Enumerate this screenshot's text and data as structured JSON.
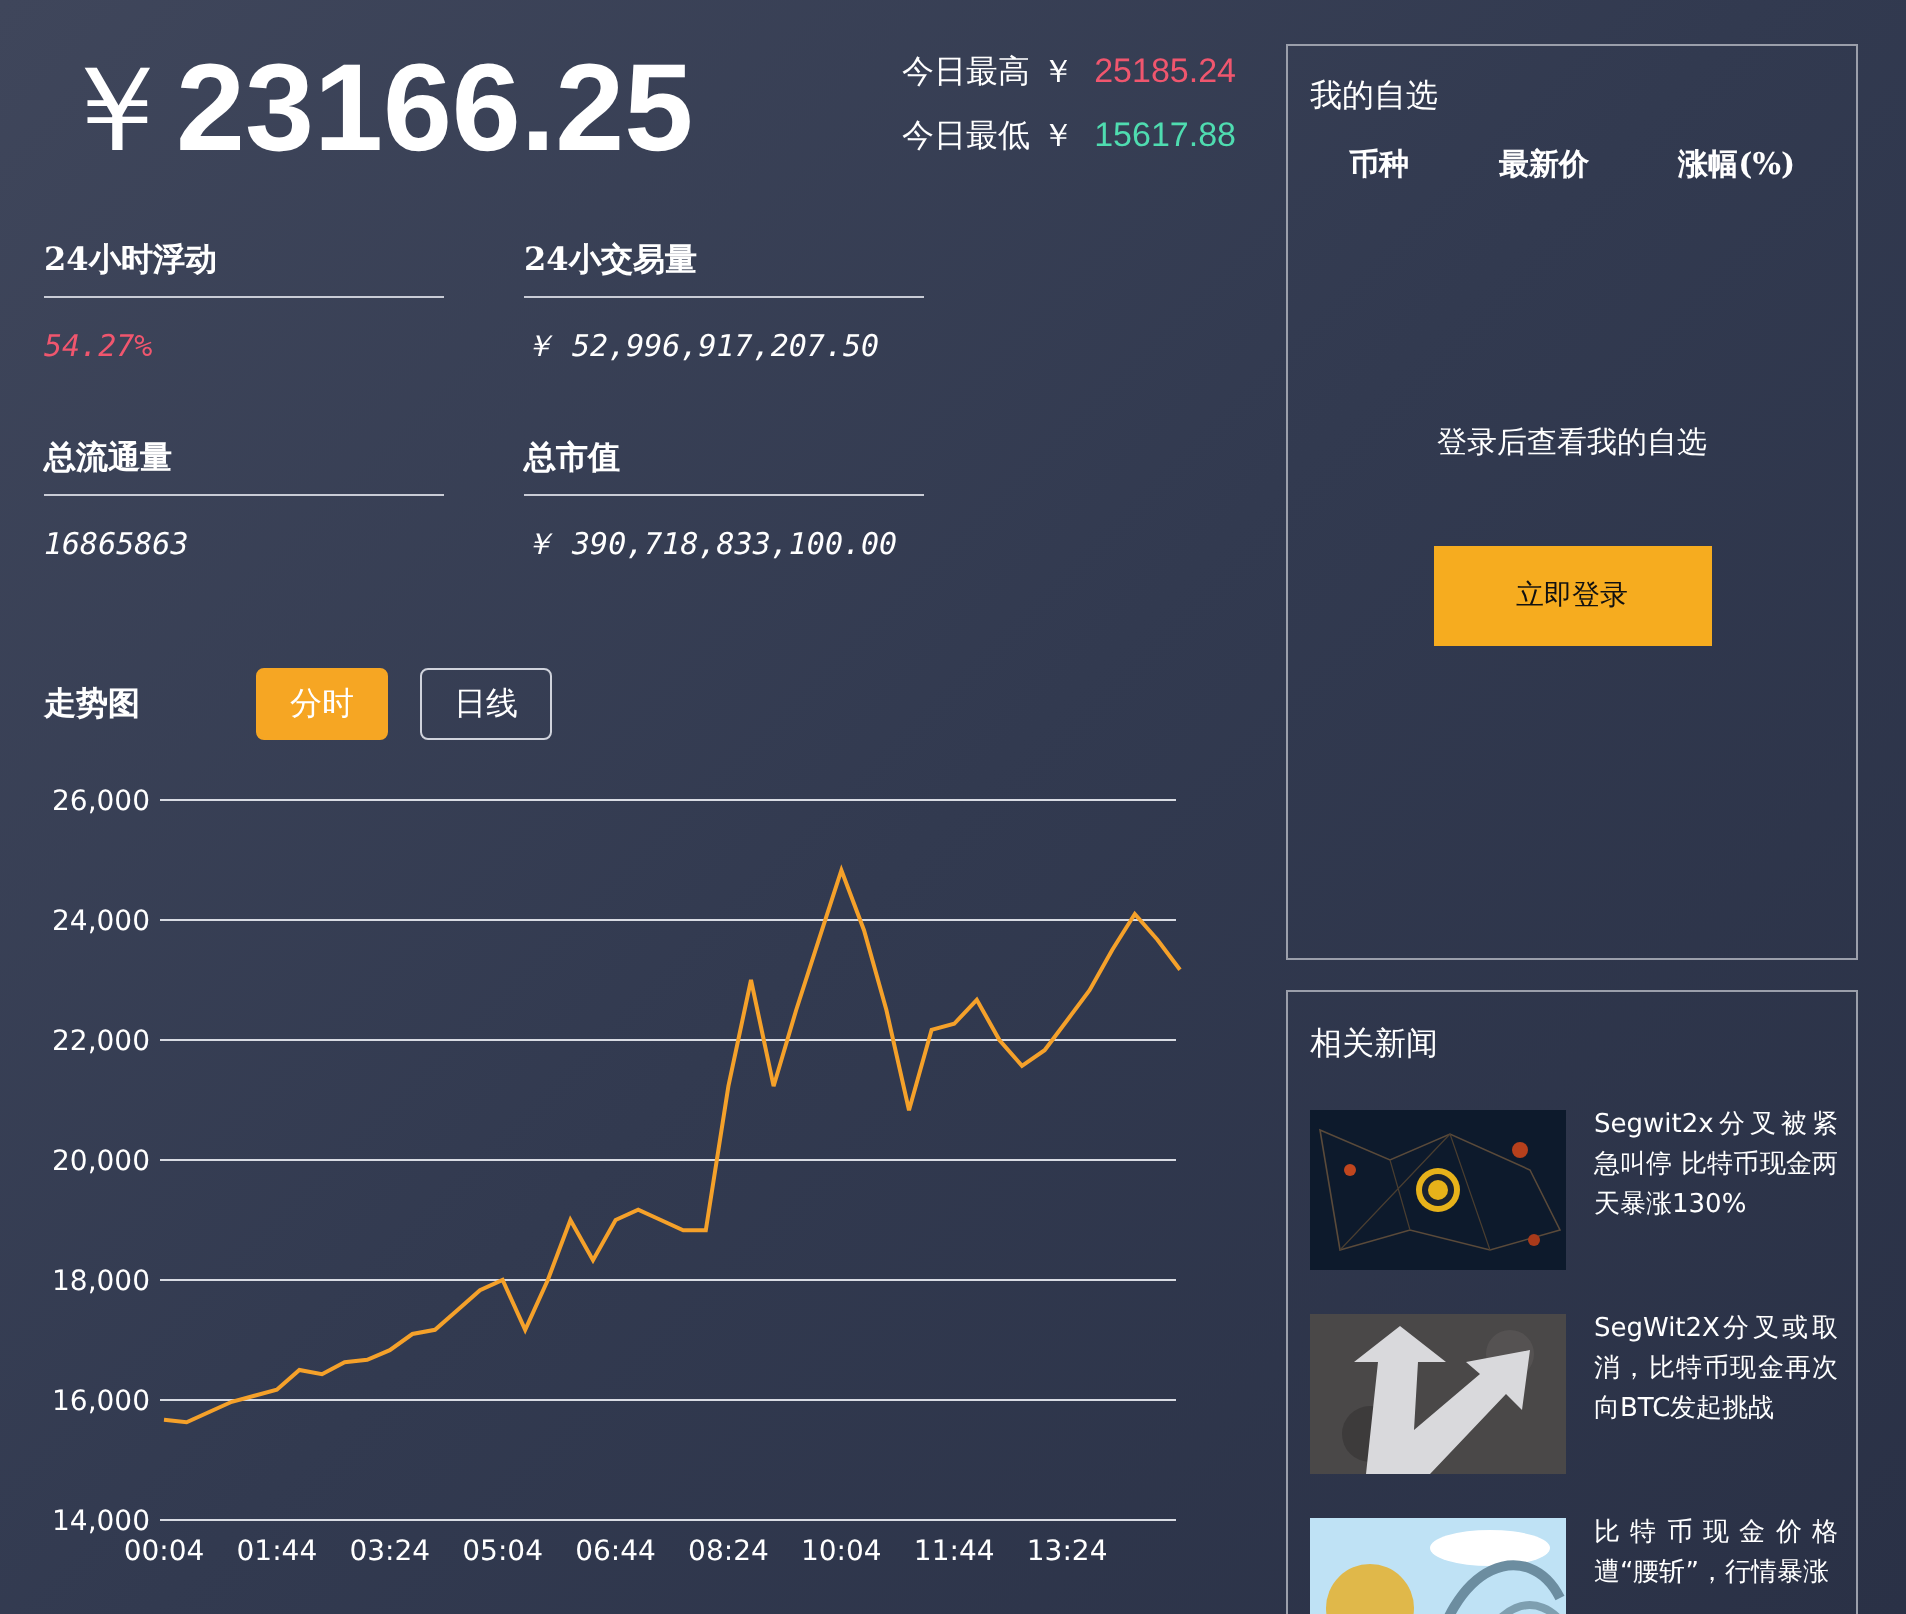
{
  "price": {
    "currency": "￥",
    "value": "23166.25"
  },
  "day_range": [
    {
      "label": "今日最高",
      "currency": "￥",
      "value": "25185.24",
      "color": "#f0566e"
    },
    {
      "label": "今日最低",
      "currency": "￥",
      "value": "15617.88",
      "color": "#4fdcb0"
    }
  ],
  "stats": [
    {
      "label": "24小时浮动",
      "value": "54.27%",
      "color": "#f0566e"
    },
    {
      "label": "24小交易量",
      "value": "￥ 52,996,917,207.50",
      "color": "#ffffff"
    },
    {
      "label": "总流通量",
      "value": "16865863",
      "color": "#ffffff"
    },
    {
      "label": "总市值",
      "value": "￥ 390,718,833,100.00",
      "color": "#ffffff"
    }
  ],
  "trend_chart": {
    "title": "走势图",
    "tabs": [
      {
        "label": "分时",
        "selected": true
      },
      {
        "label": "日线",
        "selected": false
      }
    ],
    "chart_data": {
      "type": "line",
      "categories": [
        "00:04",
        null,
        null,
        null,
        null,
        "01:44",
        null,
        null,
        null,
        null,
        "03:24",
        null,
        null,
        null,
        null,
        "05:04",
        null,
        null,
        null,
        null,
        "06:44",
        null,
        null,
        null,
        null,
        "08:24",
        null,
        null,
        null,
        null,
        "10:04",
        null,
        null,
        null,
        null,
        "11:44",
        null,
        null,
        null,
        null,
        "13:24",
        null,
        null,
        null,
        null,
        null
      ],
      "grid": true,
      "series": [
        {
          "color": "#f5a12a",
          "values": [
            15670,
            15630,
            15800,
            15970,
            16070,
            16170,
            16500,
            16430,
            16630,
            16670,
            16830,
            17100,
            17170,
            17500,
            17830,
            18000,
            17170,
            18000,
            19000,
            18330,
            19000,
            19170,
            19000,
            18830,
            18830,
            21230,
            23000,
            21230,
            22500,
            23670,
            24830,
            23830,
            22500,
            20830,
            22170,
            22270,
            22670,
            22000,
            21570,
            21830,
            22330,
            22830,
            23500,
            24100,
            23670,
            23170
          ]
        }
      ],
      "ylim": [
        14000,
        26000
      ],
      "yticks": [
        {
          "value": 14000,
          "label": "14,000"
        },
        {
          "value": 16000,
          "label": "16,000"
        },
        {
          "value": 18000,
          "label": "18,000"
        },
        {
          "value": 20000,
          "label": "20,000"
        },
        {
          "value": 22000,
          "label": "22,000"
        },
        {
          "value": 24000,
          "label": "24,000"
        },
        {
          "value": 26000,
          "label": "26,000"
        }
      ]
    }
  },
  "watchlist": {
    "title": "我的自选",
    "columns": [
      "币种",
      "最新价",
      "涨幅(%)"
    ],
    "empty_message": "登录后查看我的自选",
    "login_button": "立即登录"
  },
  "news": {
    "title": "相关新闻",
    "items": [
      {
        "kind": "picture",
        "title": "Segwit2x分叉被紧急叫停 比特币现金两天暴涨130%"
      },
      {
        "kind": "picture",
        "title": "SegWit2X分叉或取消，比特币现金再次向BTC发起挑战"
      },
      {
        "kind": "picture",
        "title": "比特币现金价格遭“腰斩”，行情暴涨"
      }
    ]
  }
}
